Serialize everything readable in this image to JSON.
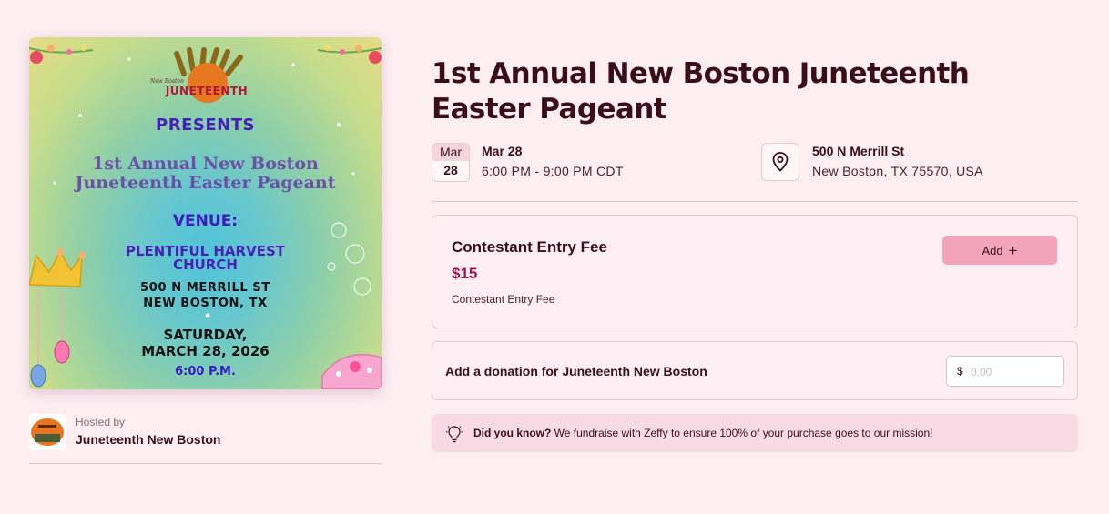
{
  "poster": {
    "logo_small": "New Boston",
    "logo_text": "JUNETEENTH",
    "presents": "PRESENTS",
    "title_line1": "1st Annual New Boston",
    "title_line2": "Juneteenth Easter Pageant",
    "venue_heading": "VENUE:",
    "venue_line1": "PLENTIFUL HARVEST",
    "venue_line2": "CHURCH",
    "address_line1": "500 N MERRILL ST",
    "address_line2": "NEW BOSTON, TX",
    "date_line1": "SATURDAY,",
    "date_line2": "MARCH 28, 2026",
    "time": "6:00 P.M."
  },
  "host": {
    "label": "Hosted by",
    "name": "Juneteenth New Boston"
  },
  "event": {
    "title": "1st Annual New Boston Juneteenth Easter Pageant",
    "calendar_month": "Mar",
    "calendar_day": "28",
    "date": "Mar 28",
    "time_range": "6:00 PM - 9:00 PM CDT",
    "location_line1": "500 N Merrill St",
    "location_line2": "New Boston, TX 75570, USA"
  },
  "ticket": {
    "name": "Contestant Entry Fee",
    "price": "$15",
    "description": "Contestant Entry Fee",
    "add_label": "Add",
    "add_icon": "plus-icon"
  },
  "donation": {
    "label": "Add a donation for Juneteenth New Boston",
    "currency": "$",
    "placeholder": "0.00"
  },
  "info": {
    "icon": "lightbulb-icon",
    "bold": "Did you know?",
    "text": " We fundraise with Zeffy to ensure 100% of your purchase goes to our mission!"
  },
  "colors": {
    "background": "#fdeef2",
    "accent_button": "#f4a3bd",
    "price": "#a3154d",
    "text": "#3a0d1c"
  }
}
